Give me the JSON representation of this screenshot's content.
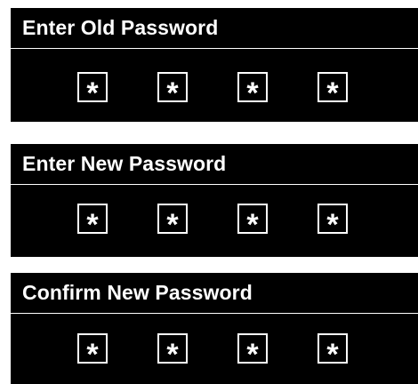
{
  "panels": {
    "old": {
      "title": "Enter Old Password",
      "digits": [
        "*",
        "*",
        "*",
        "*"
      ]
    },
    "new": {
      "title": "Enter New Password",
      "digits": [
        "*",
        "*",
        "*",
        "*"
      ]
    },
    "confirm": {
      "title": "Confirm New Password",
      "digits": [
        "*",
        "*",
        "*",
        "*"
      ]
    }
  },
  "colors": {
    "panel_background": "#000000",
    "text": "#ffffff",
    "page_background": "#ffffff"
  }
}
